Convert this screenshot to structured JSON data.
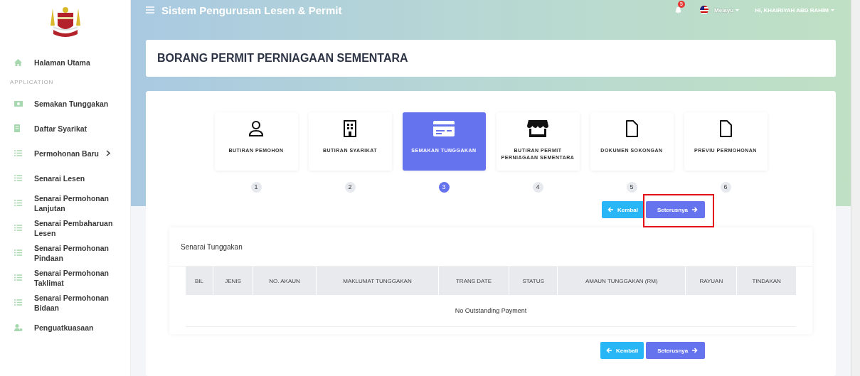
{
  "sidebar": {
    "items": [
      {
        "label": "Halaman Utama",
        "kind": "home",
        "expandable": false
      }
    ],
    "section": "APPLICATION",
    "app_items": [
      {
        "label": "Semakan Tunggakan",
        "kind": "bill",
        "expandable": false
      },
      {
        "label": "Daftar Syarikat",
        "kind": "building",
        "expandable": false
      },
      {
        "label": "Permohonan Baru",
        "kind": "list",
        "expandable": true
      },
      {
        "label": "Senarai Lesen",
        "kind": "list",
        "expandable": false
      },
      {
        "label": "Senarai Permohonan Lanjutan",
        "kind": "list",
        "expandable": false
      },
      {
        "label": "Senarai Pembaharuan Lesen",
        "kind": "list",
        "expandable": false
      },
      {
        "label": "Senarai Permohonan Pindaan",
        "kind": "list",
        "expandable": false
      },
      {
        "label": "Senarai Permohonan Taklimat",
        "kind": "list",
        "expandable": false
      },
      {
        "label": "Senarai Permohonan Bidaan",
        "kind": "list",
        "expandable": false
      },
      {
        "label": "Penguatkuasaan",
        "kind": "user",
        "expandable": false
      }
    ]
  },
  "topbar": {
    "title": "Sistem Pengurusan Lesen & Permit",
    "notification_count": "5",
    "language": "Melayu",
    "user": "HI, KHAIRIYAH ABD RAHIM"
  },
  "page_title": "BORANG PERMIT PERNIAGAAN SEMENTARA",
  "steps": [
    {
      "label": "BUTIRAN PEMOHON",
      "number": "1",
      "kind": "person",
      "selected": false
    },
    {
      "label": "BUTIRAN SYARIKAT",
      "number": "2",
      "kind": "building",
      "selected": false
    },
    {
      "label": "SEMAKAN TUNGGAKAN",
      "number": "3",
      "kind": "card",
      "selected": true
    },
    {
      "label": "BUTIRAN PERMIT PERNIAGAAN SEMENTARA",
      "number": "4",
      "kind": "store",
      "selected": false
    },
    {
      "label": "DOKUMEN SOKONGAN",
      "number": "5",
      "kind": "file",
      "selected": false
    },
    {
      "label": "PREVIU PERMOHONAN",
      "number": "6",
      "kind": "file",
      "selected": false
    }
  ],
  "top_buttons": [
    {
      "label": "Kembal",
      "kind": "back",
      "highlighted": false
    },
    {
      "label": "Seterusnya",
      "kind": "next",
      "highlighted": true
    }
  ],
  "table_card": {
    "title": "Senarai Tunggakan",
    "columns": [
      "BIL",
      "JENIS",
      "NO. AKAUN",
      "MAKLUMAT TUNGGAKAN",
      "TRANS DATE",
      "STATUS",
      "AMAUN TUNGGAKAN (RM)",
      "RAYUAN",
      "TINDAKAN"
    ],
    "empty_message": "No Outstanding Payment"
  },
  "bottom_buttons": [
    {
      "label": "Kembali",
      "kind": "back",
      "highlighted": false
    },
    {
      "label": "Seterusnya",
      "kind": "next",
      "highlighted": false
    }
  ]
}
